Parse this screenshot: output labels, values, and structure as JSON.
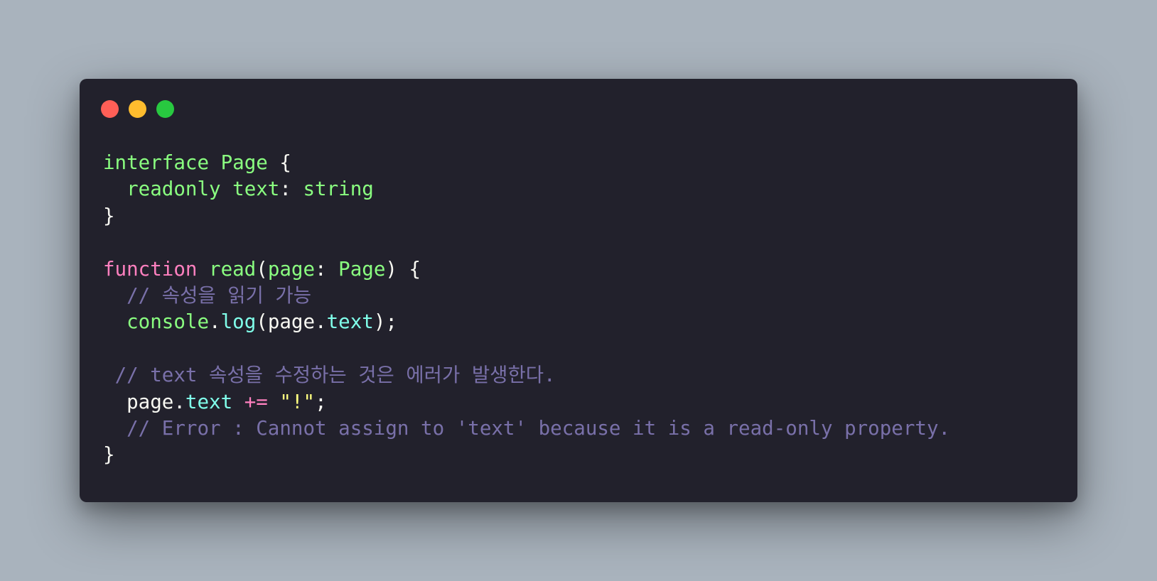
{
  "window": {
    "controls": [
      {
        "name": "close-button",
        "color": "#ff5f57"
      },
      {
        "name": "minimize-button",
        "color": "#febc2e"
      },
      {
        "name": "maximize-button",
        "color": "#28c840"
      }
    ]
  },
  "colors": {
    "background": "#a9b3bd",
    "window": "#22212c",
    "default": "#f8f8f2",
    "keyword": "#8aff80",
    "storage": "#ff80bf",
    "property": "#80ffea",
    "string": "#ffff80",
    "comment": "#7970a9"
  },
  "code": {
    "lines": [
      {
        "indent": "",
        "tokens": [
          {
            "t": "interface",
            "c": "keyword"
          },
          {
            "t": " ",
            "c": "default"
          },
          {
            "t": "Page",
            "c": "keyword"
          },
          {
            "t": " {",
            "c": "default"
          }
        ]
      },
      {
        "indent": "  ",
        "tokens": [
          {
            "t": "readonly",
            "c": "keyword"
          },
          {
            "t": " ",
            "c": "default"
          },
          {
            "t": "text",
            "c": "keyword"
          },
          {
            "t": ": ",
            "c": "default"
          },
          {
            "t": "string",
            "c": "keyword"
          }
        ]
      },
      {
        "indent": "",
        "tokens": [
          {
            "t": "}",
            "c": "default"
          }
        ]
      },
      {
        "indent": "",
        "tokens": []
      },
      {
        "indent": "",
        "tokens": [
          {
            "t": "function",
            "c": "storage"
          },
          {
            "t": " ",
            "c": "default"
          },
          {
            "t": "read",
            "c": "keyword"
          },
          {
            "t": "(",
            "c": "default"
          },
          {
            "t": "page",
            "c": "keyword"
          },
          {
            "t": ": ",
            "c": "default"
          },
          {
            "t": "Page",
            "c": "keyword"
          },
          {
            "t": ") {",
            "c": "default"
          }
        ]
      },
      {
        "indent": "  ",
        "tokens": [
          {
            "t": "// 속성을 읽기 가능",
            "c": "comment"
          }
        ]
      },
      {
        "indent": "  ",
        "tokens": [
          {
            "t": "console",
            "c": "keyword"
          },
          {
            "t": ".",
            "c": "default"
          },
          {
            "t": "log",
            "c": "property"
          },
          {
            "t": "(page.",
            "c": "default"
          },
          {
            "t": "text",
            "c": "property"
          },
          {
            "t": ");",
            "c": "default"
          }
        ]
      },
      {
        "indent": "",
        "tokens": []
      },
      {
        "indent": " ",
        "tokens": [
          {
            "t": "// text 속성을 수정하는 것은 에러가 발생한다.",
            "c": "comment"
          }
        ]
      },
      {
        "indent": "  ",
        "tokens": [
          {
            "t": "page.",
            "c": "default"
          },
          {
            "t": "text",
            "c": "property"
          },
          {
            "t": " ",
            "c": "default"
          },
          {
            "t": "+=",
            "c": "storage"
          },
          {
            "t": " ",
            "c": "default"
          },
          {
            "t": "\"!\"",
            "c": "string"
          },
          {
            "t": ";",
            "c": "default"
          }
        ]
      },
      {
        "indent": "  ",
        "tokens": [
          {
            "t": "// Error : Cannot assign to 'text' because it is a read-only property.",
            "c": "comment"
          }
        ]
      },
      {
        "indent": "",
        "tokens": [
          {
            "t": "}",
            "c": "default"
          }
        ]
      }
    ]
  }
}
